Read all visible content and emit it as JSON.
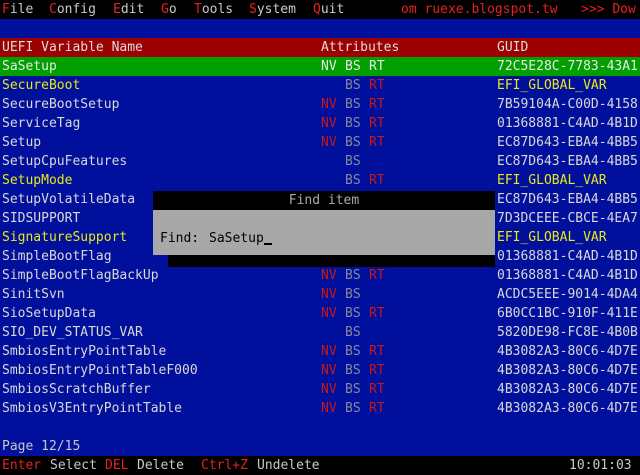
{
  "menu": {
    "items": [
      {
        "hotkey": "F",
        "rest": "ile"
      },
      {
        "hotkey": "C",
        "rest": "onfig"
      },
      {
        "hotkey": "E",
        "rest": "dit"
      },
      {
        "hotkey": "G",
        "rest": "o"
      },
      {
        "hotkey": "T",
        "rest": "ools"
      },
      {
        "hotkey": "S",
        "rest": "ystem"
      },
      {
        "hotkey": "Q",
        "rest": "uit"
      }
    ],
    "note": "om ruexe.blogspot.tw   >>> Dow"
  },
  "table": {
    "headers": {
      "name": "UEFI Variable Name",
      "attributes": "Attributes",
      "guid": "GUID"
    },
    "rows": [
      {
        "name": "SaSetup",
        "nv": "NV",
        "bs": "BS",
        "rt": "RT",
        "guid": "72C5E28C-7783-43A1"
      },
      {
        "name": "SecureBoot",
        "nv": "",
        "bs": "BS",
        "rt": "RT",
        "guid": "EFI_GLOBAL_VAR"
      },
      {
        "name": "SecureBootSetup",
        "nv": "NV",
        "bs": "BS",
        "rt": "RT",
        "guid": "7B59104A-C00D-4158"
      },
      {
        "name": "ServiceTag",
        "nv": "NV",
        "bs": "BS",
        "rt": "RT",
        "guid": "01368881-C4AD-4B1D"
      },
      {
        "name": "Setup",
        "nv": "NV",
        "bs": "BS",
        "rt": "RT",
        "guid": "EC87D643-EBA4-4BB5"
      },
      {
        "name": "SetupCpuFeatures",
        "nv": "",
        "bs": "BS",
        "rt": "",
        "guid": "EC87D643-EBA4-4BB5"
      },
      {
        "name": "SetupMode",
        "nv": "",
        "bs": "BS",
        "rt": "RT",
        "guid": "EFI_GLOBAL_VAR"
      },
      {
        "name": "SetupVolatileData",
        "nv": "",
        "bs": "",
        "rt": "",
        "guid": "EC87D643-EBA4-4BB5"
      },
      {
        "name": "SIDSUPPORT",
        "nv": "",
        "bs": "",
        "rt": "",
        "guid": "7D3DCEEE-CBCE-4EA7"
      },
      {
        "name": "SignatureSupport",
        "nv": "",
        "bs": "",
        "rt": "",
        "guid": "EFI_GLOBAL_VAR"
      },
      {
        "name": "SimpleBootFlag",
        "nv": "",
        "bs": "",
        "rt": "",
        "guid": "01368881-C4AD-4B1D"
      },
      {
        "name": "SimpleBootFlagBackUp",
        "nv": "NV",
        "bs": "BS",
        "rt": "RT",
        "guid": "01368881-C4AD-4B1D"
      },
      {
        "name": "SinitSvn",
        "nv": "NV",
        "bs": "BS",
        "rt": "",
        "guid": "ACDC5EEE-9014-4DA4"
      },
      {
        "name": "SioSetupData",
        "nv": "NV",
        "bs": "BS",
        "rt": "RT",
        "guid": "6B0CC1BC-910F-411E"
      },
      {
        "name": "SIO_DEV_STATUS_VAR",
        "nv": "",
        "bs": "BS",
        "rt": "",
        "guid": "5820DE98-FC8E-4B0B"
      },
      {
        "name": "SmbiosEntryPointTable",
        "nv": "NV",
        "bs": "BS",
        "rt": "RT",
        "guid": "4B3082A3-80C6-4D7E"
      },
      {
        "name": "SmbiosEntryPointTableF000",
        "nv": "NV",
        "bs": "BS",
        "rt": "RT",
        "guid": "4B3082A3-80C6-4D7E"
      },
      {
        "name": "SmbiosScratchBuffer",
        "nv": "NV",
        "bs": "BS",
        "rt": "RT",
        "guid": "4B3082A3-80C6-4D7E"
      },
      {
        "name": "SmbiosV3EntryPointTable",
        "nv": "NV",
        "bs": "BS",
        "rt": "RT",
        "guid": "4B3082A3-80C6-4D7E"
      }
    ]
  },
  "find_dialog": {
    "title": "Find item",
    "label": "Find:",
    "value": "SaSetup"
  },
  "status": {
    "page": "Page 12/15"
  },
  "bottom": {
    "k1": "Enter",
    "a1": "Select",
    "k2": "DEL",
    "a2": "Delete",
    "k3": "Ctrl+Z",
    "a3": "Undelete",
    "clock": "10:01:03"
  }
}
